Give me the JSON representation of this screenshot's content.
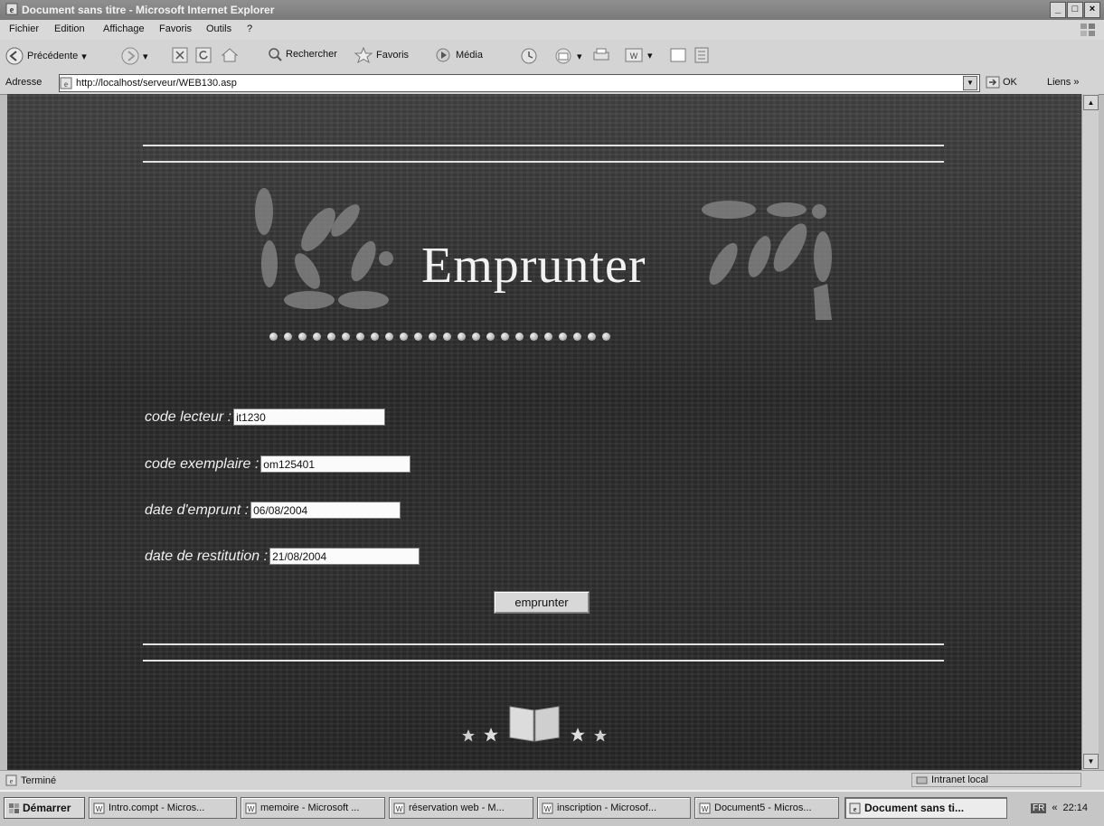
{
  "window": {
    "title": "Document sans titre - Microsoft Internet Explorer",
    "minimize": "_",
    "maximize": "□",
    "close": "×"
  },
  "menu": [
    "Fichier",
    "Edition",
    "Affichage",
    "Favoris",
    "Outils",
    "?"
  ],
  "toolbar": {
    "back": "Précédente",
    "search": "Rechercher",
    "favorites": "Favoris",
    "media": "Média"
  },
  "address": {
    "label": "Adresse",
    "url": "http://localhost/serveur/WEB130.asp",
    "go": "OK",
    "links": "Liens",
    "links_chevron": "»"
  },
  "page": {
    "heading": "Emprunter",
    "fields": [
      {
        "label": "code lecteur :",
        "value": "it1230"
      },
      {
        "label": "code exemplaire :",
        "value": "om125401"
      },
      {
        "label": "date d'emprunt :",
        "value": "06/08/2004"
      },
      {
        "label": "date de restitution :",
        "value": "21/08/2004"
      }
    ],
    "submit": "emprunter"
  },
  "status": {
    "left": "Terminé",
    "zone": "Intranet local"
  },
  "taskbar": {
    "start": "Démarrer",
    "tasks": [
      "Intro.compt - Micros...",
      "memoire - Microsoft ...",
      "réservation web - M...",
      "inscription - Microsof...",
      "Document5 - Micros...",
      "Document sans ti..."
    ],
    "lang": "FR",
    "expand": "«",
    "clock": "22:14"
  },
  "colors": {
    "page_bg": "#333333",
    "title_text": "#f2f2f2",
    "chrome": "#d4d4d4"
  }
}
